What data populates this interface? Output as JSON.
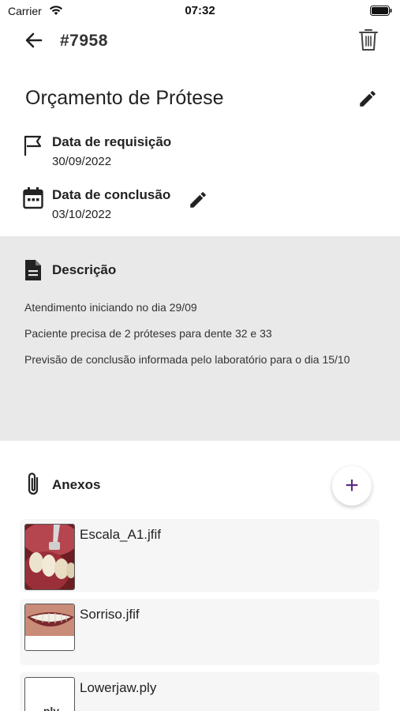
{
  "status_bar": {
    "carrier": "Carrier",
    "time": "07:32"
  },
  "header": {
    "order_id": "#7958"
  },
  "request": {
    "title": "Orçamento de Prótese",
    "requested": {
      "label": "Data de requisição",
      "value": "30/09/2022"
    },
    "completion": {
      "label": "Data de conclusão",
      "value": "03/10/2022"
    }
  },
  "description": {
    "label": "Descrição",
    "lines": [
      "Atendimento iniciando no dia 29/09",
      "Paciente precisa de 2 próteses para dente 32 e 33",
      "Previsão de conclusão informada pelo laboratório para o dia 15/10"
    ]
  },
  "attachments": {
    "label": "Anexos",
    "add_symbol": "+",
    "items": [
      {
        "name": "Escala_A1.jfif",
        "thumb": "teeth-shade-photo"
      },
      {
        "name": "Sorriso.jfif",
        "thumb": "smile-photo"
      },
      {
        "name": "Lowerjaw.ply",
        "ext": ".ply"
      }
    ]
  },
  "colors": {
    "accent": "#5b2a86",
    "panel": "#e9e9e9",
    "card": "#f6f6f6"
  }
}
